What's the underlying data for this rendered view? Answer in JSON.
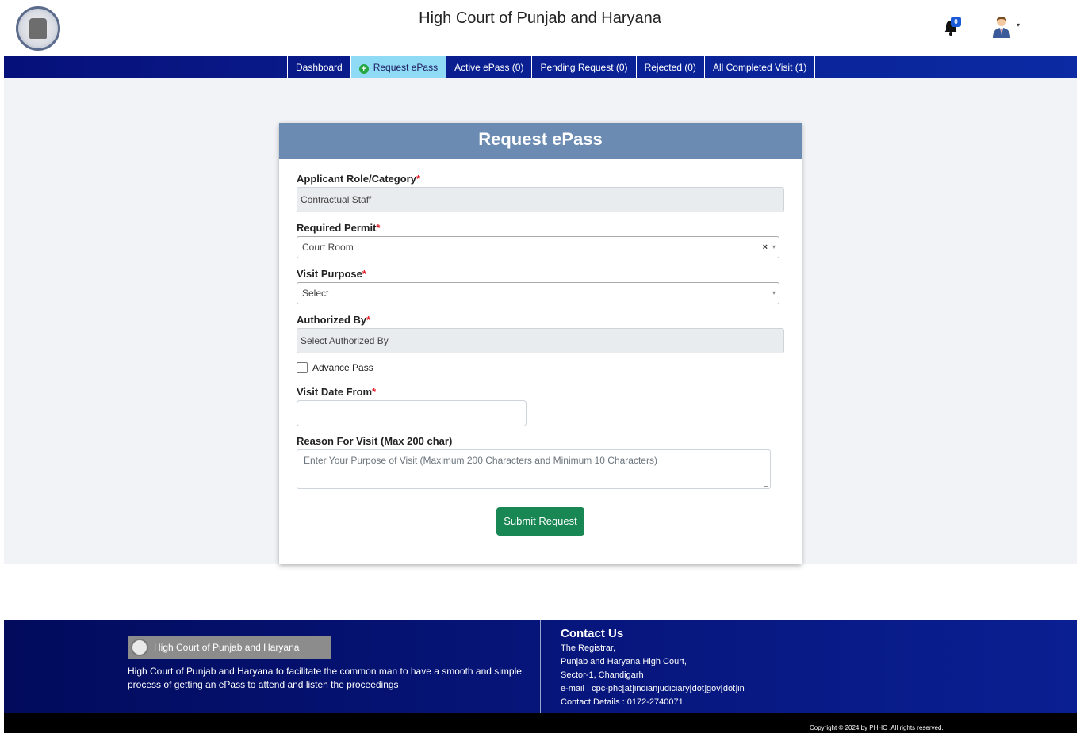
{
  "header": {
    "title": "High Court of Punjab and Haryana",
    "notification_count": "0"
  },
  "nav": {
    "items": [
      {
        "label": "Dashboard"
      },
      {
        "label": "Request ePass",
        "active": true
      },
      {
        "label": "Active ePass (0)"
      },
      {
        "label": "Pending Request (0)"
      },
      {
        "label": "Rejected (0)"
      },
      {
        "label": "All Completed Visit (1)"
      }
    ]
  },
  "form": {
    "title": "Request ePass",
    "applicant_role_label": "Applicant Role/Category",
    "applicant_role_value": "Contractual Staff",
    "required_permit_label": "Required Permit",
    "required_permit_value": "Court Room",
    "visit_purpose_label": "Visit Purpose",
    "visit_purpose_value": "Select",
    "authorized_by_label": "Authorized By",
    "authorized_by_value": "Select Authorized By",
    "advance_pass_label": "Advance Pass",
    "visit_date_label": "Visit Date From",
    "visit_date_value": "",
    "reason_label": "Reason For Visit (Max 200 char)",
    "reason_placeholder": "Enter Your Purpose of Visit (Maximum 200 Characters and Minimum 10 Characters)",
    "required_mark": "*",
    "clear_icon": "×",
    "caret_icon": "▾",
    "submit_label": "Submit Request"
  },
  "footer": {
    "brand": "High Court of Punjab and Haryana",
    "description": "High Court of Punjab and Haryana to facilitate the common man to have a smooth and simple process of getting an ePass to attend and listen the proceedings",
    "contact_title": "Contact Us",
    "contact_lines": [
      "The Registrar,",
      "Punjab and Haryana High Court,",
      "Sector-1, Chandigarh",
      "e-mail : cpc-phc[at]indianjudiciary[dot]gov[dot]in",
      "Contact Details : 0172-2740071"
    ],
    "copyright": "Copyright © 2024 by PHHC .All rights reserved."
  },
  "colors": {
    "nav_bg": "#0a1e8f",
    "active_tab": "#8fdaf5",
    "card_header": "#6c8bb3",
    "submit": "#198754",
    "required": "#e11d2a"
  }
}
